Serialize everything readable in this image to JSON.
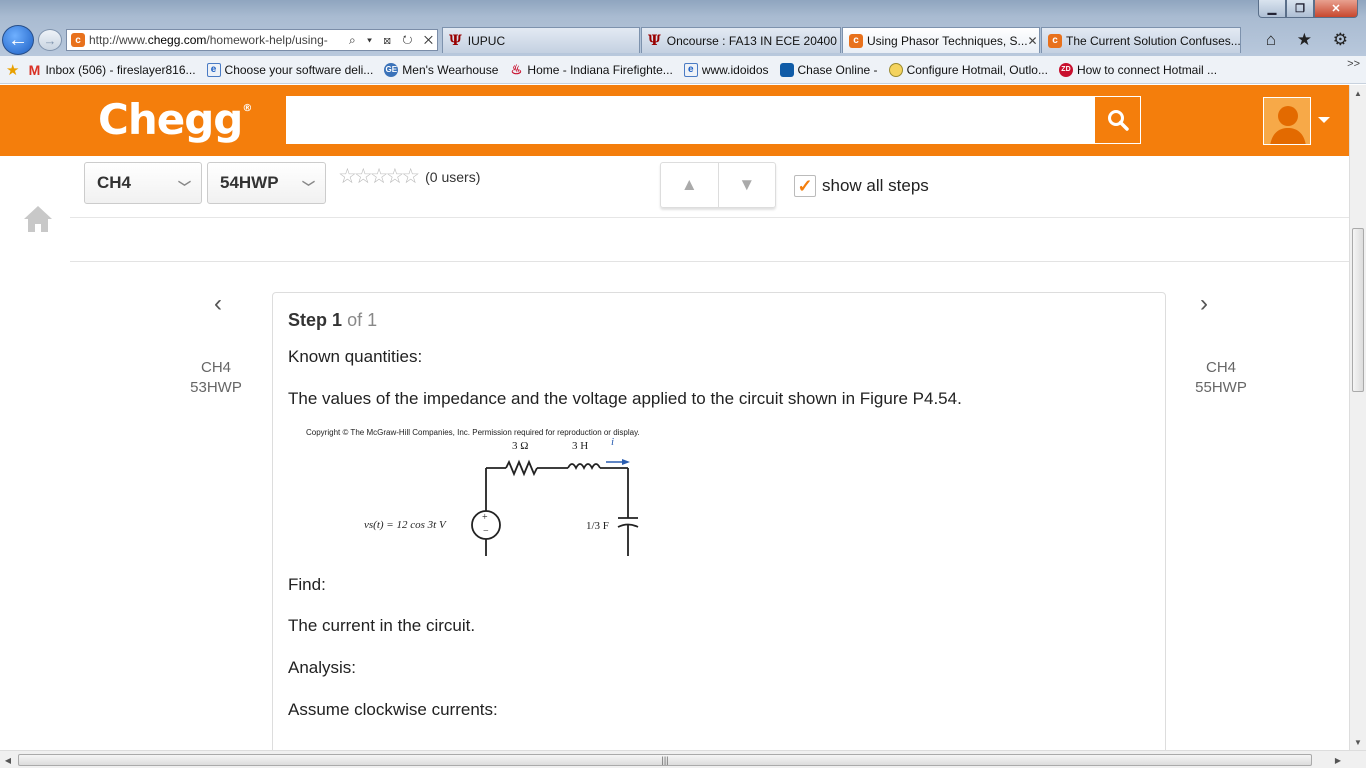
{
  "browser": {
    "address": {
      "prefix": "http://www.",
      "domain": "chegg.com",
      "path": "/homework-help/using-"
    },
    "address_icons": "⌕ ▾ ⊠ ↻ ✕",
    "tabs": [
      {
        "label": "IUPUC",
        "icon": "iu-trident-icon"
      },
      {
        "label": "Oncourse : FA13 IN ECE 20400 ...",
        "icon": "iu-trident-icon"
      },
      {
        "label": "Using Phasor Techniques, S...",
        "icon": "chegg-c-icon",
        "active": true
      },
      {
        "label": "The Current Solution Confuses...",
        "icon": "chegg-c-icon"
      }
    ],
    "chrome_icons": "⌂ ★ ⚙",
    "favorites": [
      {
        "label": "Inbox (506) - fireslayer816...",
        "icon": "gmail-icon"
      },
      {
        "label": "Choose your software deli...",
        "icon": "ie-page-icon"
      },
      {
        "label": "Men's Wearhouse",
        "icon": "ge-icon"
      },
      {
        "label": "Home - Indiana Firefighte...",
        "icon": "flame-icon"
      },
      {
        "label": "www.idoidos",
        "icon": "ie-page-icon"
      },
      {
        "label": "Chase Online -",
        "icon": "chase-icon"
      },
      {
        "label": "Configure Hotmail, Outlo...",
        "icon": "globe-icon"
      },
      {
        "label": "How to connect Hotmail ...",
        "icon": "zd-icon"
      }
    ],
    "favorites_more": ">>"
  },
  "header": {
    "logo": "Chegg",
    "logo_mark": "®",
    "search_placeholder": ""
  },
  "toolbar": {
    "chapter": "CH4",
    "problem": "54HWP",
    "rating_users": "(0 users)",
    "show_steps_label": "show all steps",
    "show_steps_checked": true
  },
  "nav": {
    "prev": {
      "chapter": "CH4",
      "problem": "53HWP"
    },
    "next": {
      "chapter": "CH4",
      "problem": "55HWP"
    }
  },
  "step": {
    "label": "Step",
    "number": "1",
    "of": "of 1",
    "known_heading": "Known quantities:",
    "known_text": "The values of the impedance and the voltage applied to the circuit shown in Figure P4.54.",
    "figure": {
      "copyright": "Copyright © The McGraw-Hill Companies, Inc. Permission required for reproduction or display.",
      "resistor": "3 Ω",
      "inductor": "3 H",
      "current": "i",
      "source": "vs(t) = 12 cos 3t V",
      "capacitor": "1/3 F",
      "plus": "+",
      "minus": "−"
    },
    "find_heading": "Find:",
    "find_text": "The current in the circuit.",
    "analysis_heading": "Analysis:",
    "analysis_text": "Assume clockwise currents:"
  },
  "colors": {
    "brand_orange": "#f47e0c"
  }
}
